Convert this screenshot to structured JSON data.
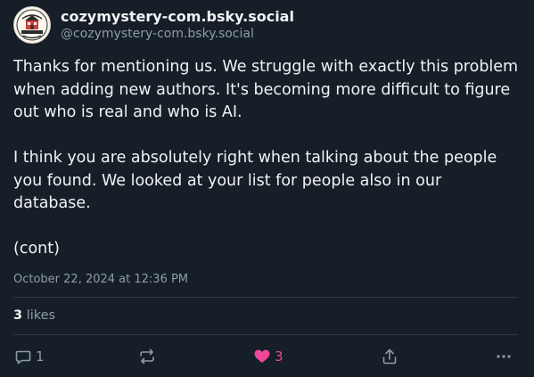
{
  "author": {
    "display_name": "cozymystery-com.bsky.social",
    "handle": "@cozymystery-com.bsky.social"
  },
  "post": {
    "paragraphs": [
      "Thanks for mentioning us. We struggle with exactly this problem when adding new authors. It's becoming more difficult to figure out who is real and who is AI.",
      "I think you are absolutely right when talking about the people you found. We looked at your list for people also in our database.",
      "(cont)"
    ],
    "timestamp": "October 22, 2024 at 12:36 PM"
  },
  "stats": {
    "likes_count": "3",
    "likes_label": "likes"
  },
  "actions": {
    "reply_count": "1",
    "like_count": "3"
  },
  "icons": {
    "reply": "reply-icon",
    "repost": "repost-icon",
    "like": "heart-icon",
    "share": "share-icon",
    "more": "more-icon"
  },
  "colors": {
    "background": "#161e27",
    "text": "#f1f3f5",
    "muted": "#8d9cac",
    "like": "#ec4899",
    "divider": "#2c3a4a"
  }
}
